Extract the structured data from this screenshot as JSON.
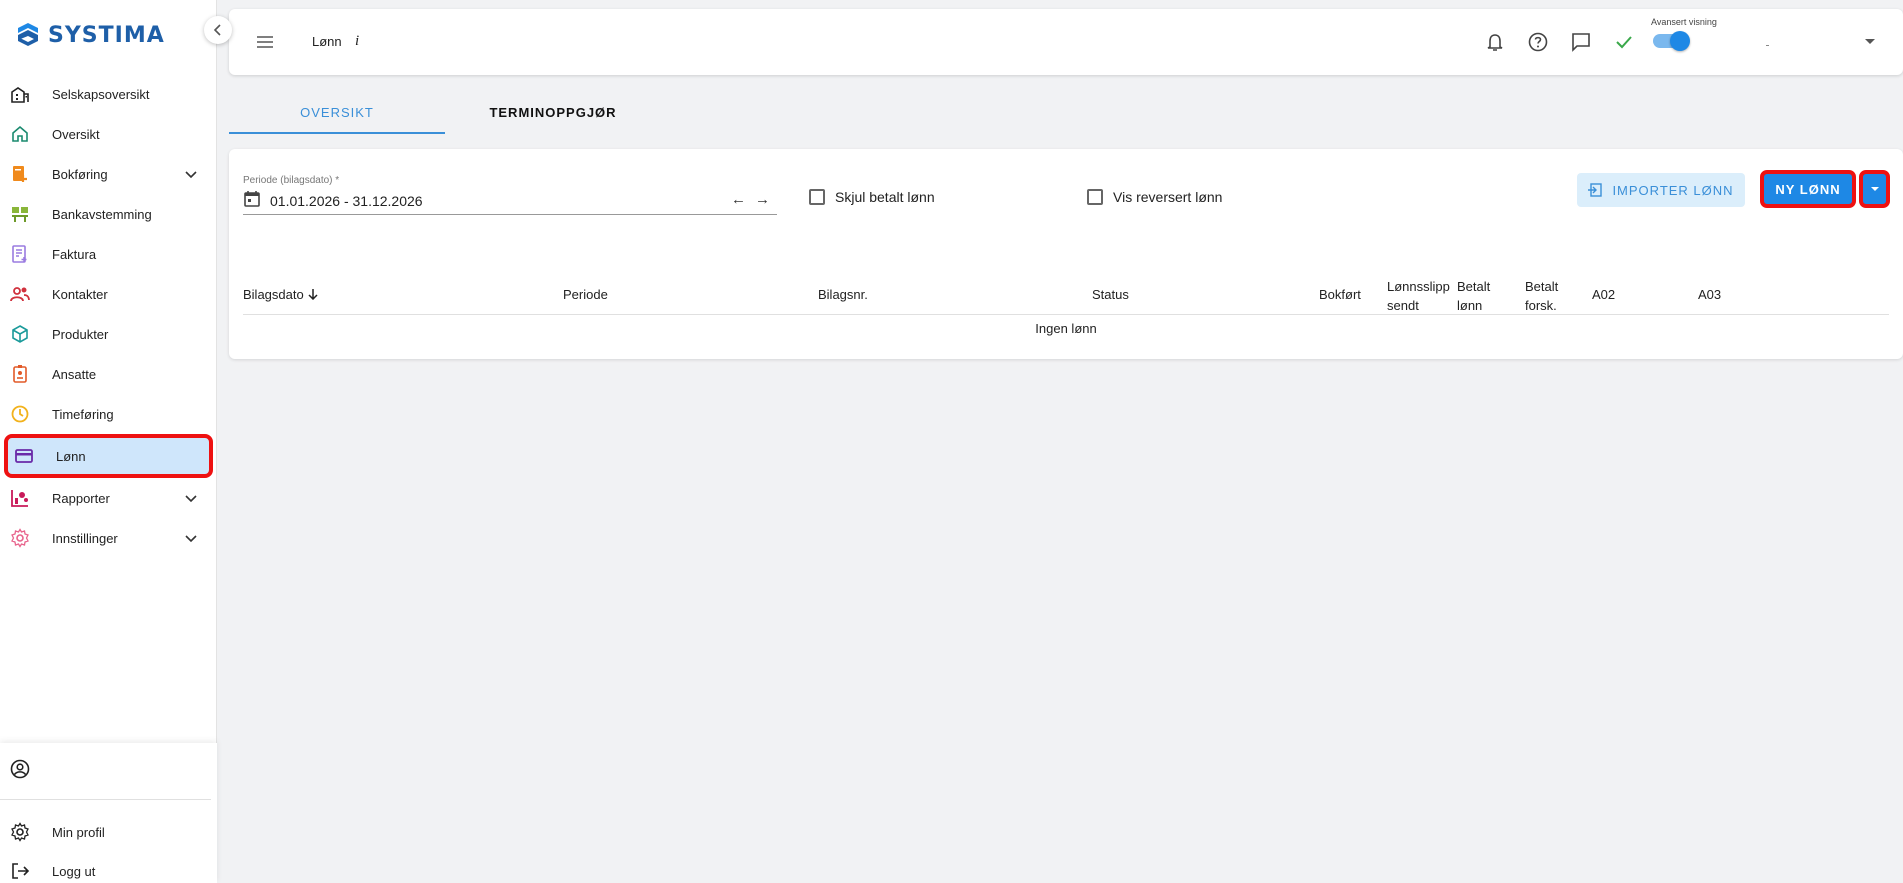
{
  "app": {
    "brand": "SYSTIMA",
    "brand_color": "#1e5fa8"
  },
  "sidebar": {
    "items": [
      {
        "label": "Selskapsoversikt",
        "icon": "buildings-icon"
      },
      {
        "label": "Oversikt",
        "icon": "home-icon"
      },
      {
        "label": "Bokføring",
        "icon": "ledger-icon",
        "expandable": true
      },
      {
        "label": "Bankavstemming",
        "icon": "bank-reconcile-icon"
      },
      {
        "label": "Faktura",
        "icon": "invoice-icon"
      },
      {
        "label": "Kontakter",
        "icon": "contacts-icon"
      },
      {
        "label": "Produkter",
        "icon": "cube-icon"
      },
      {
        "label": "Ansatte",
        "icon": "badge-icon"
      },
      {
        "label": "Timeføring",
        "icon": "clock-icon"
      },
      {
        "label": "Lønn",
        "icon": "card-icon",
        "active": true
      },
      {
        "label": "Rapporter",
        "icon": "report-icon",
        "expandable": true
      },
      {
        "label": "Innstillinger",
        "icon": "settings-gear-icon",
        "expandable": true
      }
    ],
    "bottom": {
      "profile": "Min profil",
      "logout": "Logg ut"
    }
  },
  "header": {
    "title": "Lønn",
    "info": "i",
    "advanced_label": "Avansert visning",
    "advanced_on": true
  },
  "tabs": [
    {
      "label": "OVERSIKT",
      "active": true
    },
    {
      "label": "TERMINOPPGJØR",
      "active": false
    }
  ],
  "filters": {
    "period_label": "Periode (bilagsdato) *",
    "period_value": "01.01.2026 - 31.12.2026",
    "hide_paid": "Skjul betalt lønn",
    "show_reversed": "Vis reversert lønn"
  },
  "actions": {
    "import": "IMPORTER LØNN",
    "new": "NY LØNN",
    "accent": "#1e88e5"
  },
  "table": {
    "columns": [
      {
        "label": "Bilagsdato",
        "sorted": "desc"
      },
      {
        "label": "Periode"
      },
      {
        "label": "Bilagsnr."
      },
      {
        "label": "Status"
      },
      {
        "label": "Bokført"
      },
      {
        "label": "Lønnsslipp sendt"
      },
      {
        "label": "Betalt lønn"
      },
      {
        "label": "Betalt forsk."
      },
      {
        "label": "A02"
      },
      {
        "label": "A03"
      }
    ],
    "empty": "Ingen lønn"
  }
}
